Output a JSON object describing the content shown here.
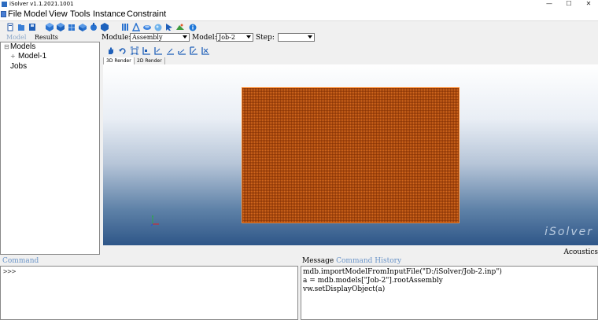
{
  "window": {
    "title": "iSolver v1.1.2021.1001",
    "minimize_glyph": "—",
    "maximize_glyph": "☐",
    "close_glyph": "✕"
  },
  "menu": {
    "items": [
      "File",
      "Model",
      "View",
      "Tools",
      "Instance",
      "Constraint"
    ]
  },
  "toolbar": {
    "icons": [
      "new-icon",
      "open-icon",
      "save-icon",
      "part-icon",
      "assembly-icon",
      "mesh-icon",
      "material-icon",
      "load-icon",
      "job-icon",
      "results-icon",
      "plot-icon",
      "sphere-icon",
      "arrow-icon",
      "cloud-icon",
      "info-icon"
    ]
  },
  "left_panel": {
    "tabs": [
      "Model",
      "Results"
    ],
    "tree": {
      "root": "Models",
      "child": "Model-1",
      "jobs": "Jobs"
    }
  },
  "module_bar": {
    "module_label": "Module:",
    "module_value": "Assembly",
    "model_label": "Model:",
    "model_value": "Job-2",
    "step_label": "Step:",
    "step_value": ""
  },
  "render_tabs": [
    "3D Render",
    "2D Render"
  ],
  "viewport": {
    "watermark": "iSolver",
    "mesh_color": "#d66a1e",
    "background_top": "#ffffff",
    "background_bottom": "#2e5688"
  },
  "status": {
    "mode": "Acoustics"
  },
  "command": {
    "label": "Command",
    "prompt": ">>>"
  },
  "message": {
    "label_active": "Message",
    "label_inactive": "Command History",
    "lines": [
      "mdb.importModelFromInputFile(\"D:/iSolver/Job-2.inp\")",
      "a = mdb.models[\"Job-2\"].rootAssembly",
      "vw.setDisplayObject(a)"
    ]
  }
}
